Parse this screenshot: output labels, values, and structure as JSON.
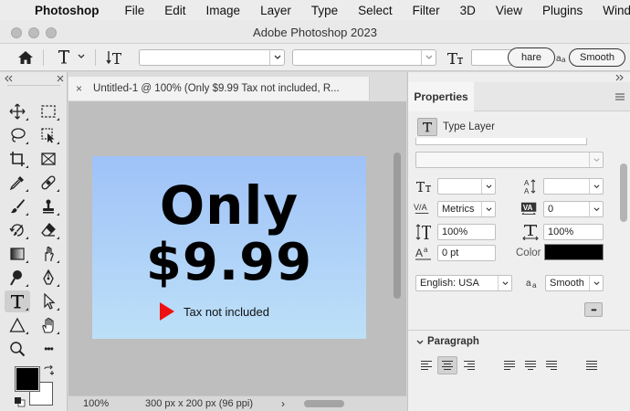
{
  "menubar": {
    "items": [
      "Photoshop",
      "File",
      "Edit",
      "Image",
      "Layer",
      "Type",
      "Select",
      "Filter",
      "3D",
      "View",
      "Plugins",
      "Windo"
    ]
  },
  "window": {
    "title": "Adobe Photoshop 2023"
  },
  "options_bar": {
    "share_label": "hare",
    "smooth_label": "Smooth"
  },
  "document": {
    "tab_title": "Untitled-1 @ 100% (Only $9.99 Tax not included, R...",
    "close_glyph": "×",
    "canvas": {
      "line1": "Only",
      "line2": "$9.99",
      "tax_note": "Tax not included",
      "gradient_top": "#9fc2f8",
      "gradient_bottom": "#bde0f8",
      "arrow_color": "#ee1111"
    },
    "status": {
      "zoom": "100%",
      "dimensions": "300 px x 200 px (96 ppi)",
      "arrow": "›"
    }
  },
  "properties": {
    "tab_label": "Properties",
    "layer_kind": "Type Layer",
    "kerning_value": "Metrics",
    "tracking_value": "0",
    "vertical_scale": "100%",
    "horizontal_scale": "100%",
    "baseline_shift": "0 pt",
    "color_label": "Color",
    "color_swatch": "#000000",
    "language": "English: USA",
    "antialias": "Smooth",
    "more_glyph": "•••",
    "paragraph_label": "Paragraph"
  },
  "tools": {
    "foreground_color": "#000000",
    "background_color": "#ffffff",
    "more_glyph": "•••"
  }
}
